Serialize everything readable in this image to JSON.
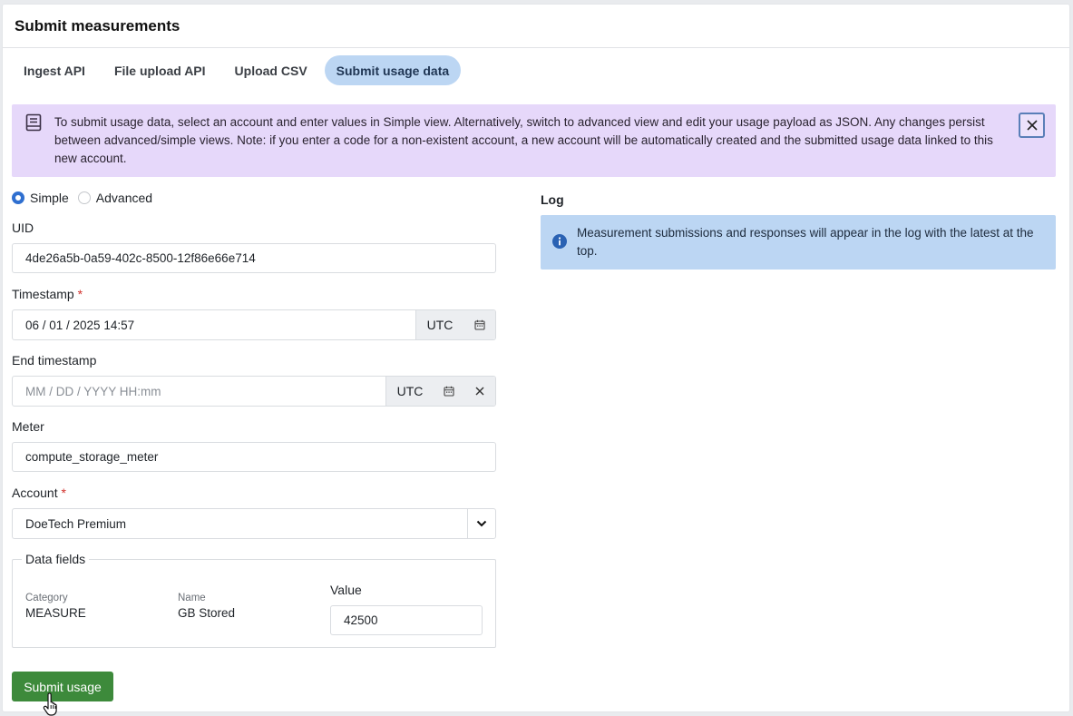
{
  "header": {
    "title": "Submit measurements"
  },
  "tabs": [
    {
      "label": "Ingest API",
      "active": false
    },
    {
      "label": "File upload API",
      "active": false
    },
    {
      "label": "Upload CSV",
      "active": false
    },
    {
      "label": "Submit usage data",
      "active": true
    }
  ],
  "notice": {
    "text": "To submit usage data, select an account and enter values in Simple view. Alternatively, switch to advanced view and edit your usage payload as JSON. Any changes persist between advanced/simple views. Note: if you enter a code for a non-existent account, a new account will be automatically created and the submitted usage data linked to this new account.",
    "icon": "book-icon",
    "close_icon": "close-icon"
  },
  "view_mode": {
    "simple_label": "Simple",
    "advanced_label": "Advanced",
    "selected": "Simple"
  },
  "form": {
    "uid_label": "UID",
    "uid_value": "4de26a5b-0a59-402c-8500-12f86e66e714",
    "timestamp_label": "Timestamp",
    "required_mark": "*",
    "timestamp_value": "06 / 01 / 2025 14:57",
    "utc_label": "UTC",
    "end_timestamp_label": "End timestamp",
    "end_timestamp_placeholder": "MM / DD / YYYY HH:mm",
    "meter_label": "Meter",
    "meter_value": "compute_storage_meter",
    "account_label": "Account",
    "account_value": "DoeTech Premium",
    "data_fields_legend": "Data fields",
    "category_header": "Category",
    "category_value": "MEASURE",
    "name_header": "Name",
    "name_value": "GB Stored",
    "value_label": "Value",
    "value_value": "42500",
    "submit_label": "Submit usage"
  },
  "log": {
    "title": "Log",
    "info_text": "Measurement submissions and responses will appear in the log with the latest at the top."
  },
  "colors": {
    "tab_active_bg": "#bcd6f3",
    "notice_bg": "#e6d8fa",
    "info_bg": "#bcd6f3",
    "submit_bg": "#3d8a3b",
    "radio_selected": "#2f6fd0",
    "required": "#d2322d"
  }
}
